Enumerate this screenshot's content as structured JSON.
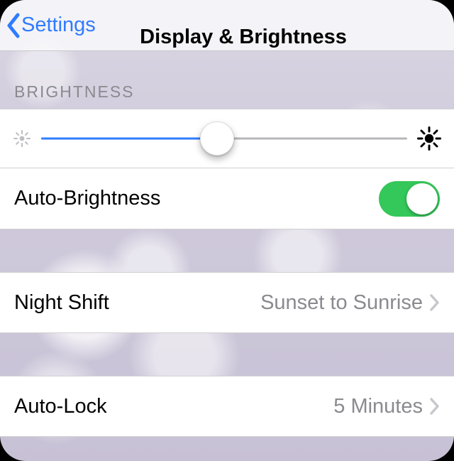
{
  "nav": {
    "back_label": "Settings",
    "title": "Display & Brightness"
  },
  "sections": {
    "brightness_header": "BRIGHTNESS"
  },
  "brightness": {
    "slider_percent": 48,
    "auto_label": "Auto-Brightness",
    "auto_on": true
  },
  "night_shift": {
    "label": "Night Shift",
    "value": "Sunset to Sunrise"
  },
  "auto_lock": {
    "label": "Auto-Lock",
    "value": "5 Minutes"
  },
  "colors": {
    "tint": "#2f7cff",
    "toggle_on": "#34c759",
    "secondary_text": "#8a8a8f"
  }
}
